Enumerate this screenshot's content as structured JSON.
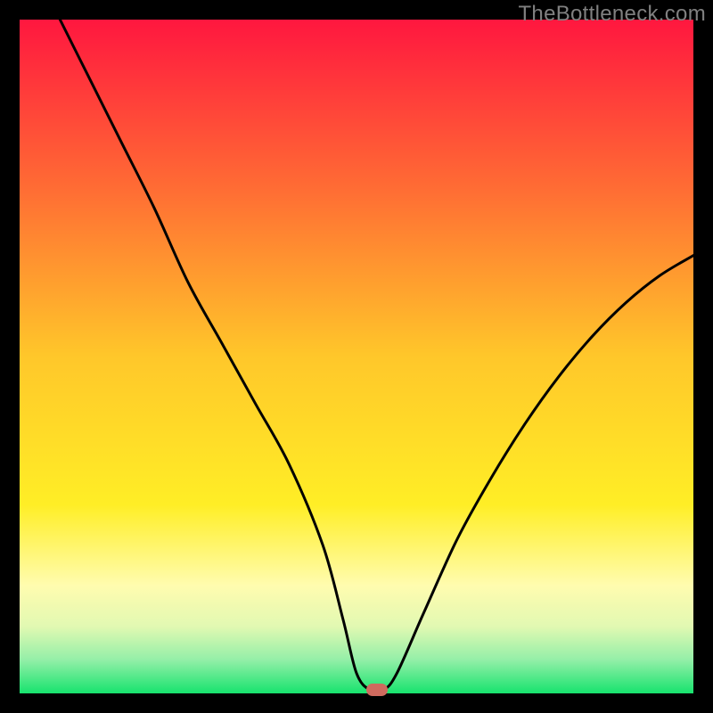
{
  "watermark": "TheBottleneck.com",
  "chart_data": {
    "type": "line",
    "title": "",
    "xlabel": "",
    "ylabel": "",
    "xlim": [
      0,
      100
    ],
    "ylim": [
      0,
      100
    ],
    "grid": false,
    "legend": false,
    "gradient_stops": [
      {
        "offset": 0,
        "color": "#ff173f"
      },
      {
        "offset": 0.25,
        "color": "#ff6c34"
      },
      {
        "offset": 0.5,
        "color": "#ffc72a"
      },
      {
        "offset": 0.72,
        "color": "#ffee26"
      },
      {
        "offset": 0.84,
        "color": "#fffcaf"
      },
      {
        "offset": 0.9,
        "color": "#e2f9b2"
      },
      {
        "offset": 0.95,
        "color": "#94efa8"
      },
      {
        "offset": 1.0,
        "color": "#17e36e"
      }
    ],
    "series": [
      {
        "name": "bottleneck-curve",
        "x": [
          6,
          10,
          15,
          20,
          25,
          30,
          35,
          40,
          45,
          48,
          50,
          52,
          54,
          56,
          60,
          65,
          70,
          75,
          80,
          85,
          90,
          95,
          100
        ],
        "y": [
          100,
          92,
          82,
          72,
          61,
          52,
          43,
          34,
          22,
          11,
          3,
          0.5,
          0.5,
          3,
          12,
          23,
          32,
          40,
          47,
          53,
          58,
          62,
          65
        ]
      }
    ],
    "optimum_marker": {
      "x": 53,
      "y": 0.5
    }
  }
}
